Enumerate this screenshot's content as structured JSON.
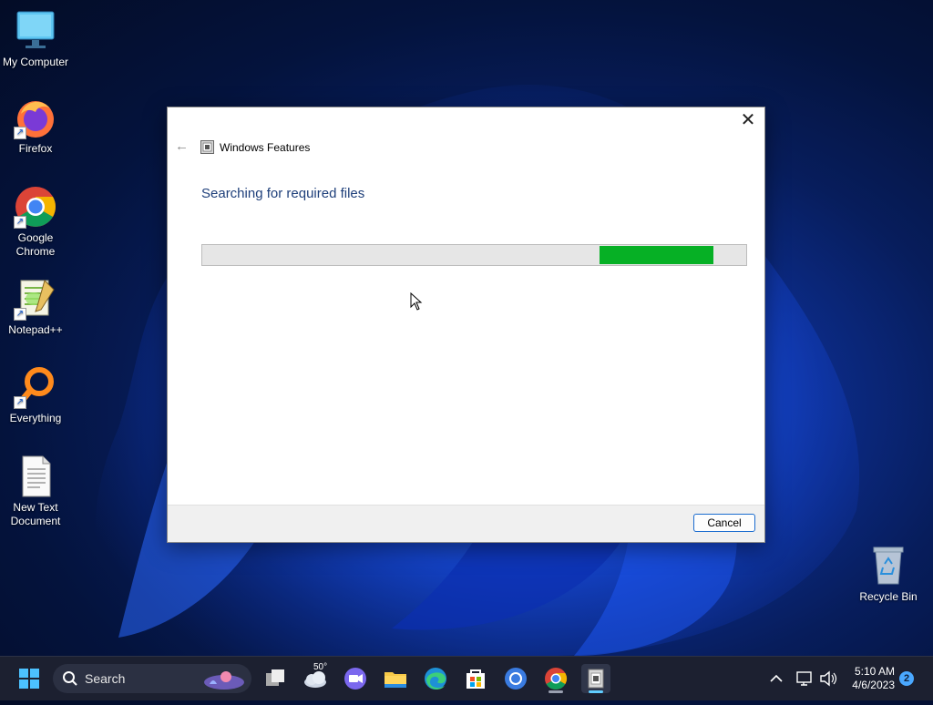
{
  "desktop": {
    "icons": [
      {
        "label": "My Computer"
      },
      {
        "label": "Firefox"
      },
      {
        "label": "Google Chrome"
      },
      {
        "label": "Notepad++"
      },
      {
        "label": "Everything"
      },
      {
        "label": "New Text Document"
      },
      {
        "label": "Recycle Bin"
      }
    ]
  },
  "dialog": {
    "window_title": "Windows Features",
    "heading": "Searching for required files",
    "progress_segment": {
      "start": 0.73,
      "end": 0.94,
      "color": "#06b025",
      "mode": "indeterminate"
    },
    "cancel_label": "Cancel"
  },
  "taskbar": {
    "search_label": "Search",
    "weather_temp": "50°",
    "pinned_icons": [
      "task-view-icon",
      "weather-icon",
      "meet-icon",
      "file-explorer-icon",
      "edge-icon",
      "store-icon",
      "chrome-alt-icon",
      "chrome-icon",
      "windows-features-icon"
    ],
    "clock_time": "5:10 AM",
    "clock_date": "4/6/2023",
    "notification_count": "2"
  },
  "colors": {
    "accent": "#1b6ccf",
    "progress": "#06b025",
    "heading": "#1e3f7a"
  }
}
